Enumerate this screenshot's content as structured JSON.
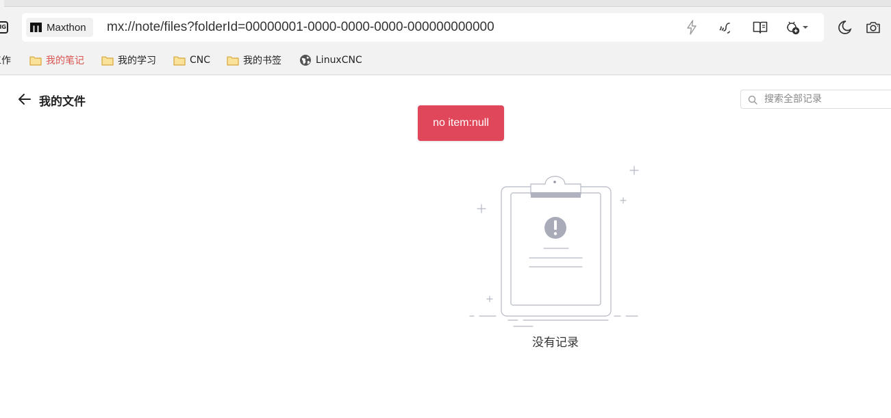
{
  "browser": {
    "site_chip_label": "Maxthon",
    "url": "mx://note/files?folderId=00000001-0000-0000-0000-000000000000",
    "left_edge_icon_text": "IG",
    "bookmarks": [
      {
        "label": "工作",
        "icon": "folder-icon",
        "color": "#222222"
      },
      {
        "label": "我的笔记",
        "icon": "folder-icon",
        "color": "#d9534f"
      },
      {
        "label": "我的学习",
        "icon": "folder-icon",
        "color": "#222222"
      },
      {
        "label": "CNC",
        "icon": "folder-icon",
        "color": "#222222"
      },
      {
        "label": "我的书签",
        "icon": "folder-icon",
        "color": "#222222"
      },
      {
        "label": "LinuxCNC",
        "icon": "globe-icon",
        "color": "#222222"
      }
    ],
    "toolbar_icons": [
      "bolt-icon",
      "read-aloud-icon",
      "reader-mode-icon",
      "extension-icon",
      "dropdown-caret-icon",
      "dark-mode-icon",
      "screenshot-icon"
    ]
  },
  "page": {
    "title": "我的文件",
    "search_placeholder": "搜索全部记录",
    "toast_message": "no item:null",
    "empty_text": "没有记录"
  },
  "colors": {
    "toast_bg": "#e0475a",
    "chrome_bg": "#f2f2f2",
    "active_bookmark": "#d9534f",
    "illustration_stroke": "#b5b8c4",
    "illustration_fill": "#a9acb8"
  }
}
